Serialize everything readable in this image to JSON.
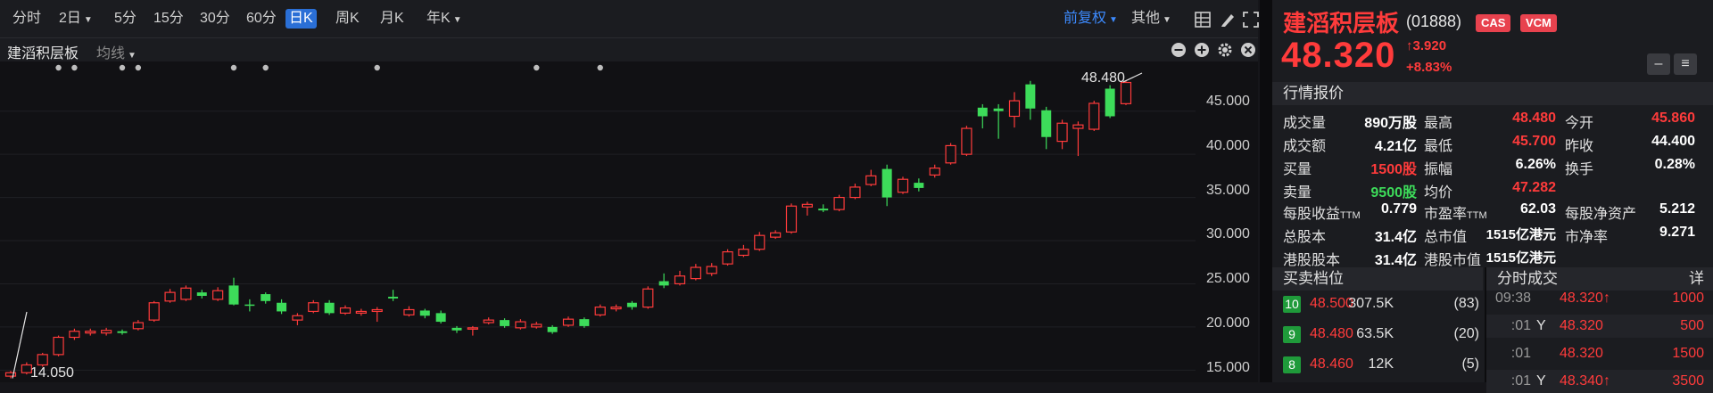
{
  "toolbar": {
    "periods": [
      "分时",
      "2日",
      "5分",
      "15分",
      "30分",
      "60分",
      "日K",
      "周K",
      "月K",
      "年K"
    ],
    "active_period": "日K",
    "adjust_label": "前复权",
    "other_label": "其他"
  },
  "subbar": {
    "title": "建滔积层板",
    "ma_label": "均线"
  },
  "chart_data": {
    "type": "candlestick",
    "y_ticks": [
      "45.000",
      "40.000",
      "35.000",
      "30.000",
      "25.000",
      "20.000",
      "15.000"
    ],
    "ylim": [
      14.0,
      49.2
    ],
    "annotations": {
      "high": "48.480",
      "low": "14.050"
    },
    "candles": [
      {
        "o": 14.3,
        "c": 14.7,
        "h": 14.9,
        "l": 14.05
      },
      {
        "o": 14.7,
        "c": 15.6,
        "h": 15.9,
        "l": 14.5
      },
      {
        "o": 15.6,
        "c": 16.8,
        "h": 17.0,
        "l": 15.4
      },
      {
        "o": 16.8,
        "c": 18.8,
        "h": 19.0,
        "l": 16.6
      },
      {
        "o": 18.8,
        "c": 19.5,
        "h": 19.8,
        "l": 18.5
      },
      {
        "o": 19.3,
        "c": 19.5,
        "h": 19.8,
        "l": 19.0
      },
      {
        "o": 19.3,
        "c": 19.6,
        "h": 19.9,
        "l": 19.0
      },
      {
        "o": 19.5,
        "c": 19.3,
        "h": 19.7,
        "l": 19.1
      },
      {
        "o": 19.8,
        "c": 20.5,
        "h": 20.8,
        "l": 19.6
      },
      {
        "o": 20.8,
        "c": 22.8,
        "h": 23.0,
        "l": 20.6
      },
      {
        "o": 23.0,
        "c": 24.0,
        "h": 24.4,
        "l": 22.8
      },
      {
        "o": 23.2,
        "c": 24.5,
        "h": 24.8,
        "l": 23.0
      },
      {
        "o": 24.0,
        "c": 23.6,
        "h": 24.3,
        "l": 23.3
      },
      {
        "o": 23.2,
        "c": 24.2,
        "h": 24.6,
        "l": 23.0
      },
      {
        "o": 24.8,
        "c": 22.6,
        "h": 25.7,
        "l": 22.5
      },
      {
        "o": 22.6,
        "c": 22.5,
        "h": 23.2,
        "l": 21.8
      },
      {
        "o": 23.8,
        "c": 23.0,
        "h": 24.0,
        "l": 22.7
      },
      {
        "o": 22.8,
        "c": 21.8,
        "h": 23.2,
        "l": 21.5
      },
      {
        "o": 20.8,
        "c": 21.3,
        "h": 21.6,
        "l": 20.2
      },
      {
        "o": 21.8,
        "c": 22.8,
        "h": 23.1,
        "l": 21.6
      },
      {
        "o": 22.8,
        "c": 21.6,
        "h": 23.1,
        "l": 21.4
      },
      {
        "o": 21.6,
        "c": 22.2,
        "h": 22.5,
        "l": 21.4
      },
      {
        "o": 21.6,
        "c": 21.8,
        "h": 22.1,
        "l": 21.3
      },
      {
        "o": 21.8,
        "c": 22.0,
        "h": 22.3,
        "l": 20.6
      },
      {
        "o": 23.5,
        "c": 23.3,
        "h": 24.3,
        "l": 23.0
      },
      {
        "o": 21.4,
        "c": 22.0,
        "h": 22.4,
        "l": 21.2
      },
      {
        "o": 21.9,
        "c": 21.3,
        "h": 22.1,
        "l": 21.0
      },
      {
        "o": 21.6,
        "c": 20.6,
        "h": 21.9,
        "l": 20.4
      },
      {
        "o": 19.9,
        "c": 19.6,
        "h": 20.1,
        "l": 19.3
      },
      {
        "o": 19.8,
        "c": 19.9,
        "h": 20.1,
        "l": 19.0
      },
      {
        "o": 20.5,
        "c": 20.8,
        "h": 21.1,
        "l": 20.3
      },
      {
        "o": 20.8,
        "c": 20.1,
        "h": 21.0,
        "l": 19.9
      },
      {
        "o": 19.9,
        "c": 20.6,
        "h": 20.9,
        "l": 19.7
      },
      {
        "o": 20.0,
        "c": 20.3,
        "h": 20.6,
        "l": 19.8
      },
      {
        "o": 20.0,
        "c": 19.4,
        "h": 20.2,
        "l": 19.2
      },
      {
        "o": 20.2,
        "c": 20.9,
        "h": 21.2,
        "l": 20.0
      },
      {
        "o": 20.9,
        "c": 20.1,
        "h": 21.1,
        "l": 19.9
      },
      {
        "o": 21.4,
        "c": 22.3,
        "h": 22.6,
        "l": 21.2
      },
      {
        "o": 22.1,
        "c": 22.3,
        "h": 22.6,
        "l": 21.8
      },
      {
        "o": 22.8,
        "c": 22.3,
        "h": 23.0,
        "l": 22.0
      },
      {
        "o": 22.3,
        "c": 24.4,
        "h": 24.7,
        "l": 22.1
      },
      {
        "o": 25.3,
        "c": 24.8,
        "h": 26.2,
        "l": 24.5
      },
      {
        "o": 25.0,
        "c": 25.9,
        "h": 26.5,
        "l": 24.8
      },
      {
        "o": 25.6,
        "c": 26.9,
        "h": 27.3,
        "l": 25.4
      },
      {
        "o": 26.2,
        "c": 27.0,
        "h": 27.4,
        "l": 25.9
      },
      {
        "o": 27.3,
        "c": 28.7,
        "h": 29.0,
        "l": 27.1
      },
      {
        "o": 28.3,
        "c": 29.0,
        "h": 29.5,
        "l": 28.1
      },
      {
        "o": 29.0,
        "c": 30.6,
        "h": 31.0,
        "l": 28.8
      },
      {
        "o": 30.4,
        "c": 30.9,
        "h": 31.2,
        "l": 30.2
      },
      {
        "o": 31.0,
        "c": 34.0,
        "h": 34.3,
        "l": 30.8
      },
      {
        "o": 33.9,
        "c": 34.2,
        "h": 34.5,
        "l": 32.9
      },
      {
        "o": 33.7,
        "c": 33.5,
        "h": 34.2,
        "l": 33.3
      },
      {
        "o": 33.6,
        "c": 35.0,
        "h": 35.3,
        "l": 33.4
      },
      {
        "o": 35.0,
        "c": 36.2,
        "h": 36.6,
        "l": 34.8
      },
      {
        "o": 36.5,
        "c": 37.5,
        "h": 38.2,
        "l": 36.3
      },
      {
        "o": 38.3,
        "c": 35.0,
        "h": 38.8,
        "l": 34.0
      },
      {
        "o": 35.6,
        "c": 37.1,
        "h": 37.4,
        "l": 35.4
      },
      {
        "o": 36.7,
        "c": 36.1,
        "h": 37.2,
        "l": 35.7
      },
      {
        "o": 37.6,
        "c": 38.4,
        "h": 38.8,
        "l": 37.3
      },
      {
        "o": 39.0,
        "c": 41.0,
        "h": 41.3,
        "l": 38.8
      },
      {
        "o": 40.0,
        "c": 43.0,
        "h": 43.3,
        "l": 39.8
      },
      {
        "o": 45.4,
        "c": 44.4,
        "h": 45.8,
        "l": 43.0
      },
      {
        "o": 45.3,
        "c": 45.0,
        "h": 45.8,
        "l": 41.8
      },
      {
        "o": 44.4,
        "c": 46.2,
        "h": 47.2,
        "l": 43.1
      },
      {
        "o": 48.1,
        "c": 45.3,
        "h": 48.5,
        "l": 44.0
      },
      {
        "o": 45.1,
        "c": 42.0,
        "h": 45.5,
        "l": 40.6
      },
      {
        "o": 41.5,
        "c": 43.6,
        "h": 44.0,
        "l": 40.6
      },
      {
        "o": 43.0,
        "c": 43.4,
        "h": 43.8,
        "l": 39.8
      },
      {
        "o": 42.9,
        "c": 45.9,
        "h": 46.2,
        "l": 42.7
      },
      {
        "o": 47.6,
        "c": 44.4,
        "h": 48.0,
        "l": 44.2
      },
      {
        "o": 45.86,
        "c": 48.32,
        "h": 48.48,
        "l": 45.7
      }
    ],
    "markers": [
      3,
      4,
      7,
      8,
      14,
      16,
      23,
      33,
      37
    ]
  },
  "quote": {
    "name": "建滔积层板",
    "code": "(01888)",
    "badges": [
      "CAS",
      "VCM"
    ],
    "price": "48.320",
    "change": "3.920",
    "change_pct": "+8.83%",
    "section_quote": "行情报价",
    "stats": [
      [
        {
          "l": "成交量",
          "v": "890万股",
          "c": "w"
        },
        {
          "l": "最高",
          "v": "48.480",
          "c": "r"
        },
        {
          "l": "今开",
          "v": "45.860",
          "c": "r"
        }
      ],
      [
        {
          "l": "成交额",
          "v": "4.21亿",
          "c": "w"
        },
        {
          "l": "最低",
          "v": "45.700",
          "c": "r"
        },
        {
          "l": "昨收",
          "v": "44.400",
          "c": "w"
        }
      ],
      [
        {
          "l": "买量",
          "v": "1500股",
          "c": "r"
        },
        {
          "l": "振幅",
          "v": "6.26%",
          "c": "w"
        },
        {
          "l": "换手",
          "v": "0.28%",
          "c": "w"
        }
      ],
      [
        {
          "l": "卖量",
          "v": "9500股",
          "c": "g"
        },
        {
          "l": "均价",
          "v": "47.282",
          "c": "r"
        }
      ]
    ],
    "stats2": [
      [
        {
          "l": "每股收益",
          "s": "TTM",
          "v": "0.779"
        },
        {
          "l": "市盈率",
          "s": "TTM",
          "v": "62.03"
        },
        {
          "l": "每股净资产",
          "s": "",
          "v": "5.212"
        }
      ],
      [
        {
          "l": "总股本",
          "s": "",
          "v": "31.4亿"
        },
        {
          "l": "总市值",
          "s": "",
          "v": "1515亿港元"
        },
        {
          "l": "市净率",
          "s": "",
          "v": "9.271"
        }
      ],
      [
        {
          "l": "港股股本",
          "s": "",
          "v": "31.4亿"
        },
        {
          "l": "港股市值",
          "s": "",
          "v": "1515亿港元"
        }
      ]
    ],
    "section_book": "买卖档位",
    "section_ticks": "分时成交",
    "ticks_detail": "详",
    "book": [
      {
        "lvl": "10",
        "price": "48.500",
        "vol": "307.5K",
        "cnt": "83"
      },
      {
        "lvl": "9",
        "price": "48.480",
        "vol": "63.5K",
        "cnt": "20"
      },
      {
        "lvl": "8",
        "price": "48.460",
        "vol": "12K",
        "cnt": "5"
      }
    ],
    "ticks": [
      {
        "time": "09:38",
        "flag": "",
        "price": "48.320↑",
        "vol": "1000"
      },
      {
        "time": ":01",
        "flag": "Y",
        "price": "48.320",
        "vol": "500"
      },
      {
        "time": ":01",
        "flag": "",
        "price": "48.320",
        "vol": "1500"
      },
      {
        "time": ":01",
        "flag": "Y",
        "price": "48.340↑",
        "vol": "3500"
      }
    ]
  }
}
